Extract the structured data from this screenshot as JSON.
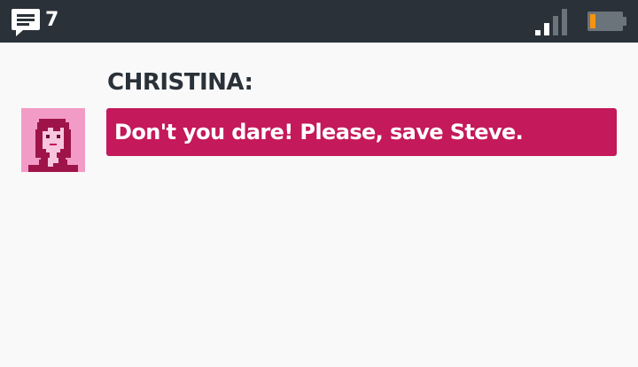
{
  "status_bar": {
    "message_count": "7",
    "message_icon": "chat-bubble-icon",
    "signal_icon": "signal-strength-icon",
    "battery_icon": "battery-low-icon",
    "colors": {
      "bar_background": "#2a3138",
      "battery_level": "#f7930e",
      "icon_light": "#ffffff",
      "icon_dim": "#6b737b"
    }
  },
  "chat": {
    "speaker": "CHRISTINA:",
    "message": "Don't you dare! Please, save Steve.",
    "avatar_icon": "christina-portrait-icon",
    "colors": {
      "bubble": "#c4195a",
      "avatar_background": "#f29bc6",
      "speaker_text": "#2a3138"
    }
  }
}
